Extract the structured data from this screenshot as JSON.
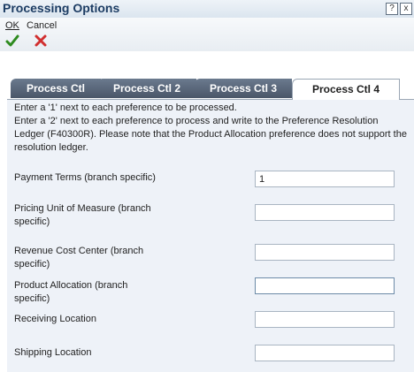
{
  "window": {
    "title": "Processing Options",
    "help_icon": "?",
    "close_icon": "x"
  },
  "toolbar": {
    "ok_label": "OK",
    "cancel_label": "Cancel"
  },
  "tabs": [
    {
      "label": "Process Ctl",
      "active": false
    },
    {
      "label": "Process Ctl 2",
      "active": false
    },
    {
      "label": "Process Ctl 3",
      "active": false
    },
    {
      "label": "Process Ctl 4",
      "active": true
    }
  ],
  "intro": {
    "line1": "Enter a '1' next to each preference to be processed.",
    "line2": "Enter a '2' next to each preference to process and write to the Preference Resolution Ledger (F40300R). Please note that the Product Allocation preference does not support the resolution ledger."
  },
  "options": [
    {
      "label": "Payment Terms (branch specific)",
      "value": "1"
    },
    {
      "label": "Pricing Unit of Measure (branch specific)",
      "value": ""
    },
    {
      "label": "Revenue Cost Center (branch specific)",
      "value": ""
    },
    {
      "label": "Product Allocation (branch specific)",
      "value": ""
    },
    {
      "label": "Receiving Location",
      "value": ""
    },
    {
      "label": "Shipping Location",
      "value": ""
    }
  ],
  "colors": {
    "accent": "#1c3c63",
    "ok_check": "#2e8b1f",
    "cancel_x": "#d12f2f",
    "panel_bg": "#eef2f8"
  }
}
